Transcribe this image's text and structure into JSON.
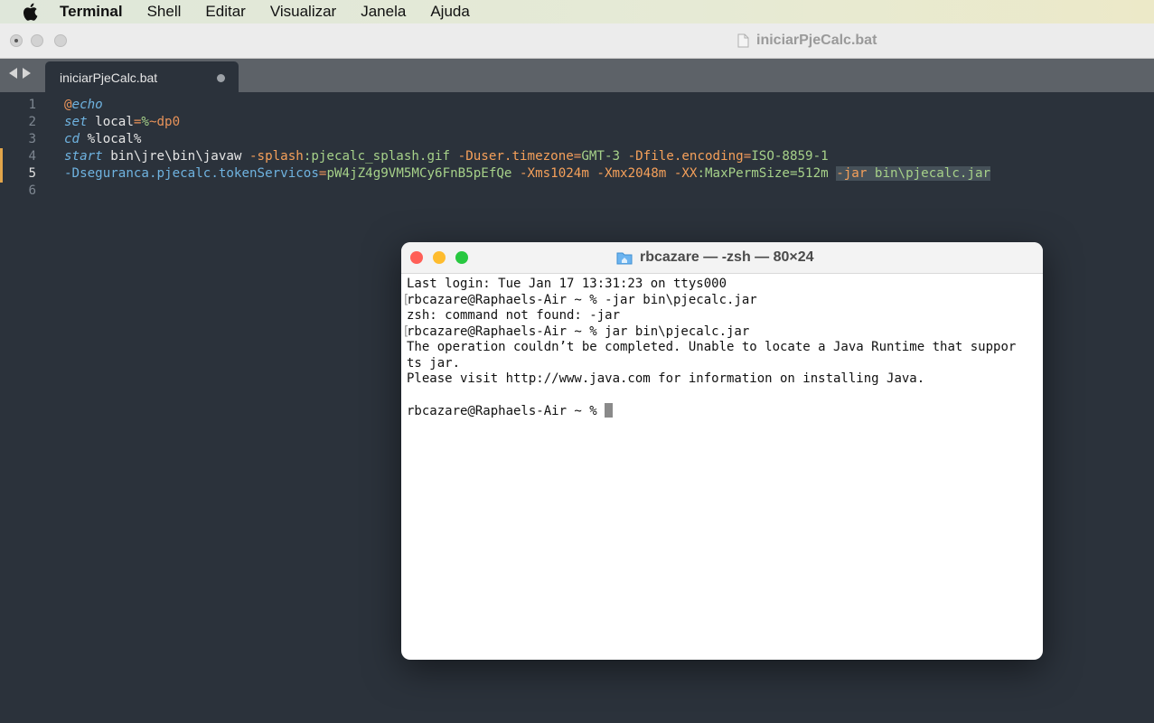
{
  "menubar": {
    "app": "Terminal",
    "items": [
      "Shell",
      "Editar",
      "Visualizar",
      "Janela",
      "Ajuda"
    ]
  },
  "editor_window": {
    "title": "iniciarPjeCalc.bat",
    "tab": {
      "label": "iniciarPjeCalc.bat"
    },
    "line_numbers": [
      "1",
      "2",
      "3",
      "4",
      "5",
      "6"
    ],
    "lines": [
      [
        {
          "t": "@",
          "c": "c-at"
        },
        {
          "t": "echo",
          "c": "c-kw"
        }
      ],
      [
        {
          "t": "set",
          "c": "c-kw"
        },
        {
          "t": " local",
          "c": "c-plain"
        },
        {
          "t": "=",
          "c": "c-op"
        },
        {
          "t": "%",
          "c": "c-str"
        },
        {
          "t": "~dp0",
          "c": "c-num"
        }
      ],
      [
        {
          "t": "cd",
          "c": "c-kw"
        },
        {
          "t": " %local%",
          "c": "c-plain"
        }
      ],
      [
        {
          "t": "start",
          "c": "c-kw"
        },
        {
          "t": " bin\\jre\\bin\\javaw ",
          "c": "c-plain"
        },
        {
          "t": "-splash",
          "c": "c-flag"
        },
        {
          "t": ":pjecalc_splash.gif ",
          "c": "c-str"
        },
        {
          "t": "-Duser",
          "c": "c-flag"
        },
        {
          "t": ".timezone",
          "c": "c-flag"
        },
        {
          "t": "=",
          "c": "c-op"
        },
        {
          "t": "GMT-3 ",
          "c": "c-str"
        },
        {
          "t": "-Dfile",
          "c": "c-flag"
        },
        {
          "t": ".encoding",
          "c": "c-flag"
        },
        {
          "t": "=",
          "c": "c-op"
        },
        {
          "t": "ISO-8859-1",
          "c": "c-str"
        }
      ],
      [
        {
          "t": "-Dseguranca",
          "c": "c-prop"
        },
        {
          "t": ".pjecalc",
          "c": "c-prop"
        },
        {
          "t": ".tokenServicos",
          "c": "c-prop"
        },
        {
          "t": "=",
          "c": "c-op"
        },
        {
          "t": "pW4jZ4g9VM5MCy6FnB5pEfQe ",
          "c": "c-str"
        },
        {
          "t": "-Xms1024m ",
          "c": "c-flag"
        },
        {
          "t": "-Xmx2048m ",
          "c": "c-flag"
        },
        {
          "t": "-XX",
          "c": "c-flag"
        },
        {
          "t": ":MaxPermSize=512m ",
          "c": "c-str"
        },
        {
          "t": "-jar",
          "c": "c-flag sel"
        },
        {
          "t": " bin\\pjecalc.jar",
          "c": "c-str sel"
        }
      ],
      []
    ],
    "active_line": 5
  },
  "terminal": {
    "title": "rbcazare — -zsh — 80×24",
    "lines": [
      "Last login: Tue Jan 17 13:31:23 on ttys000",
      "rbcazare@Raphaels-Air ~ % -jar bin\\pjecalc.jar",
      "zsh: command not found: -jar",
      "rbcazare@Raphaels-Air ~ % jar bin\\pjecalc.jar",
      "The operation couldn’t be completed. Unable to locate a Java Runtime that suppor",
      "ts jar.",
      "Please visit http://www.java.com for information on installing Java.",
      "",
      "rbcazare@Raphaels-Air ~ % "
    ],
    "bracketed_lines": [
      1,
      3
    ]
  },
  "icons": {
    "apple": "apple-logo-icon",
    "document": "document-icon",
    "folder": "home-folder-icon"
  },
  "colors": {
    "editor_bg": "#2b323b",
    "keyword": "#6fb3e0",
    "string": "#a6d189",
    "flag": "#f5a05a",
    "close": "#ff5f57",
    "minimize": "#febc2e",
    "zoom": "#28c840"
  }
}
